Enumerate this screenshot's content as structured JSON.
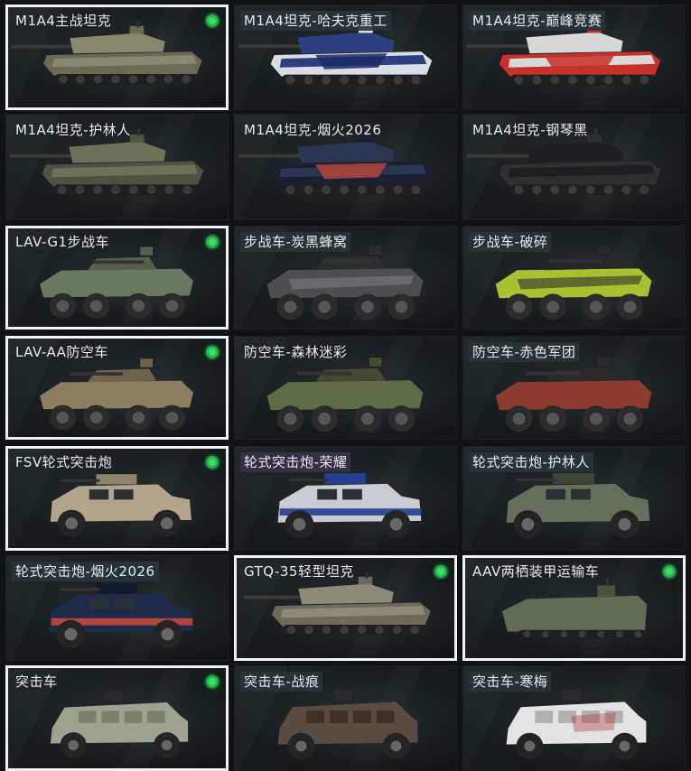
{
  "colors": {
    "owned_border": "#f2f2f2",
    "owned_check": "#27b24a"
  },
  "vehicles": [
    {
      "name": "M1A4主战坦克",
      "owned": true,
      "kind": "tank",
      "tag": "none",
      "body": "#8a876e",
      "accent": "#6b6a55",
      "stripe": ""
    },
    {
      "name": "M1A4坦克-哈夫克重工",
      "owned": false,
      "kind": "tank",
      "tag": "dark",
      "body": "#2d3f7e",
      "accent": "#d9dde6",
      "stripe": "#1a2a63"
    },
    {
      "name": "M1A4坦克-巅峰竞赛",
      "owned": false,
      "kind": "tank",
      "tag": "dark",
      "body": "#d8d8d8",
      "accent": "#c8312b",
      "stripe": "#c8312b"
    },
    {
      "name": "M1A4坦克-护林人",
      "owned": false,
      "kind": "tank",
      "tag": "none",
      "body": "#6c7258",
      "accent": "#4d5340",
      "stripe": ""
    },
    {
      "name": "M1A4坦克-烟火2026",
      "owned": false,
      "kind": "tank",
      "tag": "none",
      "body": "#2b3450",
      "accent": "#1a1f33",
      "stripe": "#b3463b"
    },
    {
      "name": "M1A4坦克-钢琴黑",
      "owned": false,
      "kind": "tank",
      "tag": "none",
      "body": "#1e1f20",
      "accent": "#2e2f30",
      "stripe": ""
    },
    {
      "name": "LAV-G1步战车",
      "owned": true,
      "kind": "ifv",
      "tag": "none",
      "body": "#6b7860",
      "accent": "#55604c",
      "stripe": ""
    },
    {
      "name": "步战车-炭黑蜂窝",
      "owned": false,
      "kind": "ifv",
      "tag": "dark",
      "body": "#4b4f50",
      "accent": "#2c2f30",
      "stripe": "#7a7d7e"
    },
    {
      "name": "步战车-破碎",
      "owned": false,
      "kind": "ifv",
      "tag": "dark",
      "body": "#a7c231",
      "accent": "#25282a",
      "stripe": "#2b2e30"
    },
    {
      "name": "LAV-AA防空车",
      "owned": true,
      "kind": "aa",
      "tag": "none",
      "body": "#8d7e62",
      "accent": "#6f634d",
      "stripe": ""
    },
    {
      "name": "防空车-森林迷彩",
      "owned": false,
      "kind": "aa",
      "tag": "none",
      "body": "#5f6a47",
      "accent": "#434b33",
      "stripe": ""
    },
    {
      "name": "防空车-赤色军团",
      "owned": false,
      "kind": "aa",
      "tag": "dark",
      "body": "#8c3b2f",
      "accent": "#2b2a2a",
      "stripe": ""
    },
    {
      "name": "FSV轮式突击炮",
      "owned": true,
      "kind": "mrap",
      "tag": "none",
      "body": "#b4a48b",
      "accent": "#8f826d",
      "stripe": ""
    },
    {
      "name": "轮式突击炮-荣耀",
      "owned": false,
      "kind": "mrap",
      "tag": "purple",
      "body": "#c9cdd3",
      "accent": "#24408f",
      "stripe": "#24408f"
    },
    {
      "name": "轮式突击炮-护林人",
      "owned": false,
      "kind": "mrap",
      "tag": "dark",
      "body": "#65705a",
      "accent": "#3e4538",
      "stripe": ""
    },
    {
      "name": "轮式突击炮-烟火2026",
      "owned": false,
      "kind": "mrap",
      "tag": "dark",
      "body": "#1f2a4a",
      "accent": "#12182c",
      "stripe": "#c3473a"
    },
    {
      "name": "GTQ-35轻型坦克",
      "owned": true,
      "kind": "ltank",
      "tag": "none",
      "body": "#8f8a78",
      "accent": "#6d695b",
      "stripe": ""
    },
    {
      "name": "AAV两栖装甲运输车",
      "owned": true,
      "kind": "aav",
      "tag": "none",
      "body": "#626b55",
      "accent": "#4b5242",
      "stripe": ""
    },
    {
      "name": "突击车",
      "owned": true,
      "kind": "truck",
      "tag": "none",
      "body": "#9ea391",
      "accent": "#7b8070",
      "stripe": ""
    },
    {
      "name": "突击车-战痕",
      "owned": false,
      "kind": "truck",
      "tag": "dark",
      "body": "#5a4b40",
      "accent": "#3c3029",
      "stripe": ""
    },
    {
      "name": "突击车-寒梅",
      "owned": false,
      "kind": "truck",
      "tag": "dark",
      "body": "#e3e3e3",
      "accent": "#b0b0b0",
      "stripe": "#b33a3a"
    }
  ]
}
